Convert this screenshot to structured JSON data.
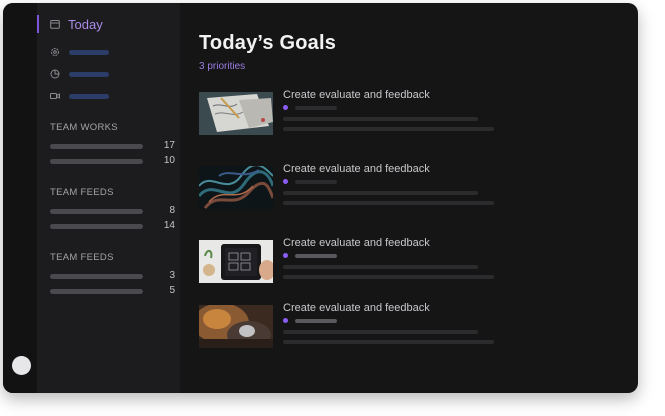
{
  "sidebar": {
    "today_label": "Today",
    "nav_icons": [
      "calendar-icon",
      "settings-icon",
      "pie-chart-icon",
      "video-icon"
    ],
    "sections": [
      {
        "title": "TEAM WORKS",
        "counts": [
          "17",
          "10"
        ]
      },
      {
        "title": "TEAM FEEDS",
        "counts": [
          "8",
          "14"
        ]
      },
      {
        "title": "TEAM FEEDS",
        "counts": [
          "3",
          "5"
        ]
      }
    ]
  },
  "main": {
    "title": "Today’s Goals",
    "subtitle": "3 priorities",
    "tasks": [
      {
        "title": "Create evaluate and feedback"
      },
      {
        "title": "Create evaluate and feedback"
      },
      {
        "title": "Create evaluate and feedback"
      },
      {
        "title": "Create evaluate and feedback"
      }
    ]
  },
  "colors": {
    "window_bg": "#151516",
    "sidebar_bg": "#1c1c1e",
    "accent": "#8b5cf6",
    "accent_text": "#a98ae8"
  }
}
